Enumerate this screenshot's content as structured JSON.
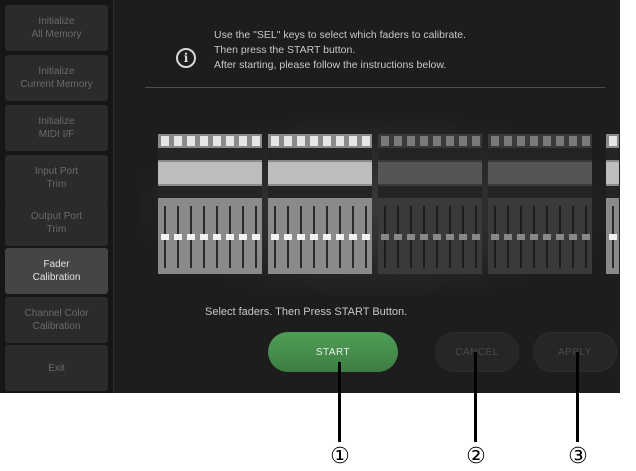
{
  "sidebar": {
    "items": [
      {
        "label": "Initialize\nAll Memory",
        "active": false
      },
      {
        "label": "Initialize\nCurrent Memory",
        "active": false
      },
      {
        "label": "Initialize\nMIDI I/F",
        "active": false
      },
      {
        "label": "Input Port\nTrim",
        "active": false
      },
      {
        "label": "Output Port\nTrim",
        "active": false
      },
      {
        "label": "Fader\nCalibration",
        "active": true
      },
      {
        "label": "Channel Color\nCalibration",
        "active": false
      },
      {
        "label": "Exit",
        "active": false
      }
    ]
  },
  "info": {
    "icon": "info-icon",
    "glyph": "i",
    "lines": [
      "Use the \"SEL\" keys to select which faders to calibrate.",
      "Then press the START button.",
      "After starting, please follow the instructions below."
    ]
  },
  "mixer": {
    "groups": [
      {
        "strips": 8,
        "selected": true
      },
      {
        "strips": 8,
        "selected": true
      },
      {
        "strips": 8,
        "selected": false
      },
      {
        "strips": 8,
        "selected": false
      },
      {
        "strips": 1,
        "selected": true
      }
    ]
  },
  "status_message": "Select faders. Then Press START Button.",
  "buttons": {
    "start": "START",
    "cancel": "CANCEL",
    "apply": "APPLY"
  },
  "callouts": [
    "①",
    "②",
    "③"
  ],
  "colors": {
    "accent_green": "#4f9e55",
    "background": "#1d1d1d",
    "sidebar_active": "#454545"
  }
}
